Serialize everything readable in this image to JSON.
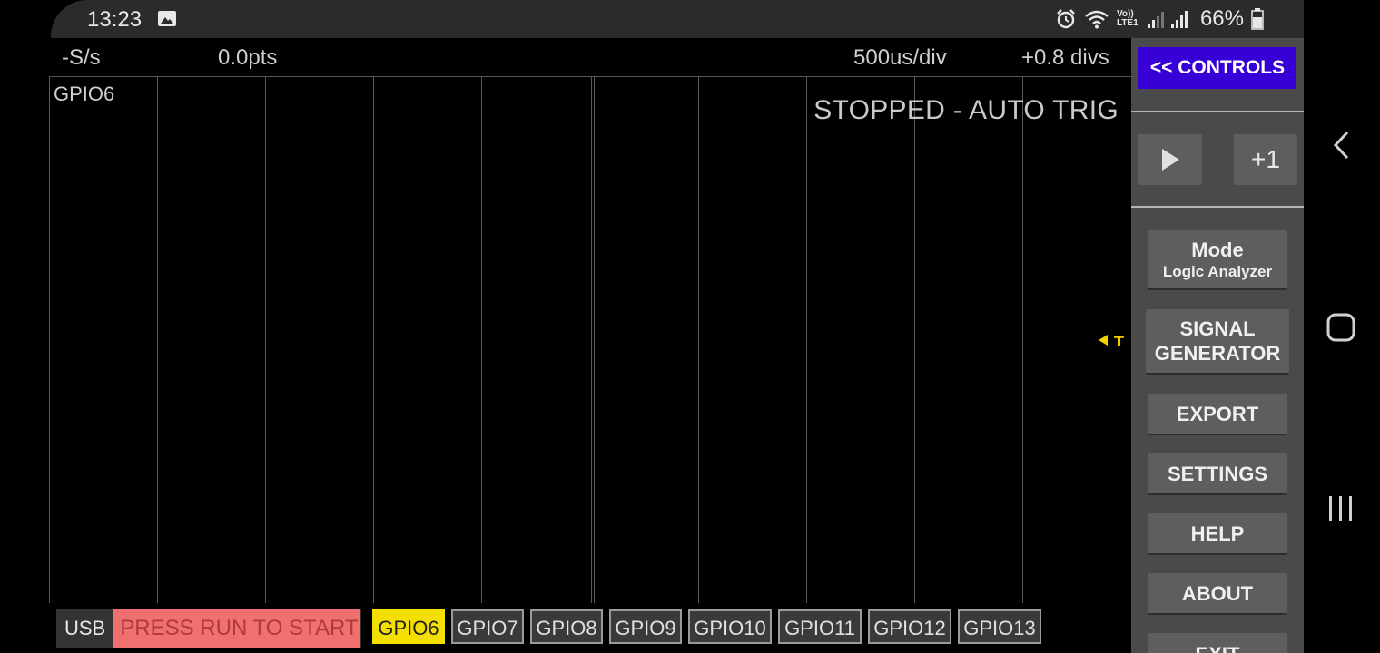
{
  "status_bar": {
    "time": "13:23",
    "image_icon": "image-icon",
    "alarm_icon": "alarm-icon",
    "wifi_icon": "wifi-icon",
    "volte_label": "Vo)) LTE1",
    "signal_icon": "signal-icon",
    "battery_percent": "66%",
    "battery_icon": "battery-icon"
  },
  "scope": {
    "sample_rate": "-S/s",
    "points": "0.0pts",
    "timebase": "500us/div",
    "trigger_offset": "+0.8 divs",
    "channel_label": "GPIO6",
    "run_state": "STOPPED - AUTO TRIG",
    "trigger_marker": "T"
  },
  "bottom_bar": {
    "usb_tag": "USB",
    "usb_message": "PRESS RUN TO START",
    "channels": [
      "GPIO6",
      "GPIO7",
      "GPIO8",
      "GPIO9",
      "GPIO10",
      "GPIO11",
      "GPIO12",
      "GPIO13"
    ],
    "active_channel": "GPIO6"
  },
  "controls": {
    "toggle_label": "<< CONTROLS",
    "run_icon": "play-icon",
    "step_label": "+1",
    "mode_title": "Mode",
    "mode_value": "Logic Analyzer",
    "signal_generator_line1": "SIGNAL",
    "signal_generator_line2": "GENERATOR",
    "export_label": "EXPORT",
    "settings_label": "SETTINGS",
    "help_label": "HELP",
    "about_label": "ABOUT",
    "exit_label": "EXIT"
  },
  "nav_bar": {
    "back_icon": "back-icon",
    "home_icon": "home-icon",
    "recents_icon": "recents-icon"
  },
  "colors": {
    "controls_accent": "#3700d6",
    "active_channel": "#f4e000",
    "usb_status_bg": "#f07070",
    "trigger_marker": "#f4d000"
  }
}
